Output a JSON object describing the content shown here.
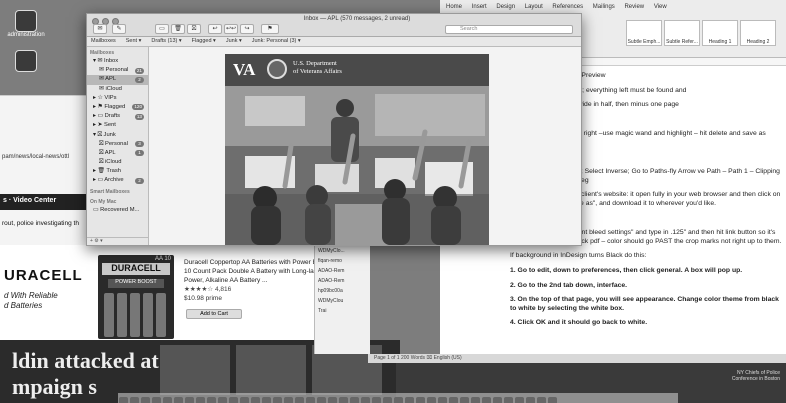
{
  "desktop": {
    "icons": [
      {
        "label": "administration"
      },
      {
        "label": ""
      }
    ]
  },
  "browser_bg": {
    "url": "pam/news/local-news/ottl",
    "nav": "s ·   Video Center",
    "snippet": "rout, police investigating th"
  },
  "amazon": {
    "brand": "URACELL",
    "tagline": "d With Reliable\nd Batteries",
    "pack_brand": "DURACELL",
    "pack_size": "AA 10",
    "pack_boost": "POWER BOOST",
    "description": "Duracell Coppertop AA Batteries with Power Boost, 10 Count Pack Double A Battery with Long-lasting Power, Alkaline AA Battery ...",
    "rating": "4,816",
    "price": "$10.98 prime",
    "cart_button": "Add to Cart"
  },
  "news": {
    "headline_1": "ldin attacked at",
    "headline_2": "mpaign s"
  },
  "files": [
    "WDMyClo...",
    "fiqan-remo",
    "ADAO-Rem",
    "ADAO-Rem",
    "hp09bc00a",
    "WDMyClou",
    "Trai"
  ],
  "mail": {
    "title": "Inbox — APL (570 messages, 2 unread)",
    "search_placeholder": "Search",
    "toolbar": {
      "compose": "✎",
      "archive": "▭",
      "trash": "🗑",
      "reply": "↩",
      "reply_all": "↩↩",
      "forward": "↪",
      "flag": "⚑",
      "move": "▾"
    },
    "favorites": [
      "Mailboxes",
      "Sent ▾",
      "Drafts (13) ▾",
      "Flagged ▾",
      "Junk ▾",
      "Junk: Personal (3) ▾"
    ],
    "sidebar": {
      "header": "Mailboxes",
      "items": [
        {
          "label": "▾ ✉ Inbox",
          "count": "",
          "indent": false,
          "selected": false
        },
        {
          "label": "✉ Personal",
          "count": "21",
          "indent": true,
          "selected": false
        },
        {
          "label": "✉ APL",
          "count": "2",
          "indent": true,
          "selected": true
        },
        {
          "label": "✉ iCloud",
          "count": "",
          "indent": true,
          "selected": false
        },
        {
          "label": "▸ ☆ VIPs",
          "count": "",
          "indent": false,
          "selected": false
        },
        {
          "label": "▸ ⚑ Flagged",
          "count": "120",
          "indent": false,
          "selected": false
        },
        {
          "label": "▸ ▭ Drafts",
          "count": "13",
          "indent": false,
          "selected": false
        },
        {
          "label": "▸ ➤ Sent",
          "count": "",
          "indent": false,
          "selected": false
        },
        {
          "label": "▾ ⛝ Junk",
          "count": "",
          "indent": false,
          "selected": false
        },
        {
          "label": "⛝ Personal",
          "count": "3",
          "indent": true,
          "selected": false
        },
        {
          "label": "⛝ APL",
          "count": "1",
          "indent": true,
          "selected": false
        },
        {
          "label": "⛝ iCloud",
          "count": "",
          "indent": true,
          "selected": false
        },
        {
          "label": "▸ 🗑 Trash",
          "count": "",
          "indent": false,
          "selected": false
        },
        {
          "label": "▸ ▭ Archive",
          "count": "2",
          "indent": false,
          "selected": false
        }
      ],
      "smart_header": "Smart Mailboxes",
      "onmymac_header": "On My Mac",
      "recovered": "▭ Recovered M...",
      "bottom": "+  ⚙ ▾"
    },
    "va": {
      "logo": "VA",
      "dept_line1": "U.S. Department",
      "dept_line2": "of Veterans Affairs"
    }
  },
  "word": {
    "tabs": [
      "Home",
      "Insert",
      "Design",
      "Layout",
      "References",
      "Mailings",
      "Review",
      "View"
    ],
    "styles": [
      "Subtle Emph...",
      "Subtle Refer...",
      "Heading 1",
      "Heading 2"
    ],
    "body": [
      {
        "text": "int Production – Output Preview",
        "bold": false
      },
      {
        "text": "t should be in document; everything left must be found and",
        "bold": false
      },
      {
        "text": "pread in document – divide in half, then minus one page",
        "bold": false
      },
      {
        "text": "unds]",
        "bold": false
      },
      {
        "text": "tshop – unlock image at right –use magic wand and highlight – hit delete and save as Photoshop file or .tiff",
        "bold": false
      },
      {
        "text": "oshop",
        "bold": false
      },
      {
        "text": "ect what you don't want; Select Inverse; Go to Paths-fly Arrow ve Path – Path 1 – Clipping Path 2; then save as .jpeg",
        "bold": false
      },
      {
        "text": "aded images sent from client's website: it open fully in your web browser and then click on your select, \"save image as\", and download it to wherever you'd like.",
        "bold": false
      },
      {
        "text": "Hi-Res pdf with bleeds:",
        "bold": false
      },
      {
        "text": "Click OFF \"use document bleed settings\" and type in .125\" and then hit link button so it's all the way around. Check pdf – color should go PAST the crop marks not right up to them.",
        "bold": false
      },
      {
        "text": "If background in InDesign turns Black do this:",
        "bold": false
      },
      {
        "text": "1. Go to edit, down to preferences, then click general. A box will pop up.",
        "bold": true
      },
      {
        "text": "2. Go to the 2nd tab down, interface.",
        "bold": true
      },
      {
        "text": "3. On the top of that page, you will see appearance. Change color theme from black to white by selecting the white box.",
        "bold": true
      },
      {
        "text": "4. Click OK and it should go back to white.",
        "bold": true
      }
    ],
    "status": "Page 1 of 1    200 Words    ⌧    English (US)"
  },
  "photo_caption": "NY Chiefs of Police\nConference in Boston"
}
